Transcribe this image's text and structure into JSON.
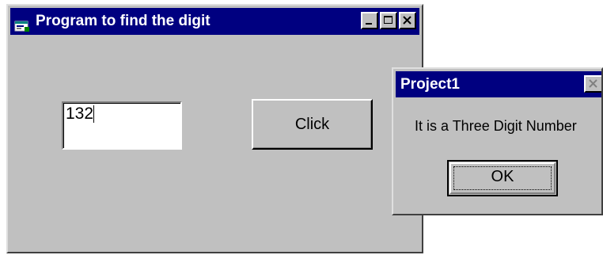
{
  "main_window": {
    "title": "Program to find the digit",
    "icon": "app-form-icon",
    "caption_buttons": [
      "minimize-icon",
      "maximize-icon",
      "close-icon"
    ],
    "input_value": "132",
    "button_label": "Click"
  },
  "message_box": {
    "title": "Project1",
    "message": "It is a Three Digit Number",
    "ok_label": "OK",
    "caption_buttons": [
      "close-icon"
    ]
  },
  "colors": {
    "titlebar": "#000080",
    "face": "#c0c0c0",
    "title_text": "#ffffff"
  }
}
